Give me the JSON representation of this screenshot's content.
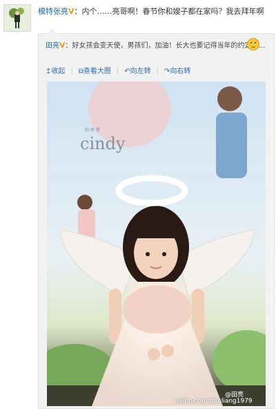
{
  "post": {
    "author": "模特张亮",
    "separator": "：",
    "text": "内个……亮哥啊！春节你和嫂子都在家吗？我去拜年啊"
  },
  "repost": {
    "author": "田亮",
    "separator": "：",
    "text": "好女孩会变天使，男孩们，加油！长大也要记得当年的约定啊…",
    "toolbar": {
      "collapse": "收起",
      "view_large": "查看大图",
      "rotate_left": "向左转",
      "rotate_right": "向右转"
    }
  },
  "photo": {
    "backdrop_text": "cindy",
    "backdrop_small_text": "田 雨 橙",
    "watermark_handle": "@田亮",
    "watermark_url": "weibo.com/tianliang1979"
  },
  "colors": {
    "link": "#1d68ad",
    "badge": "#f29b1a",
    "repost_bg": "#f2f2f2"
  }
}
